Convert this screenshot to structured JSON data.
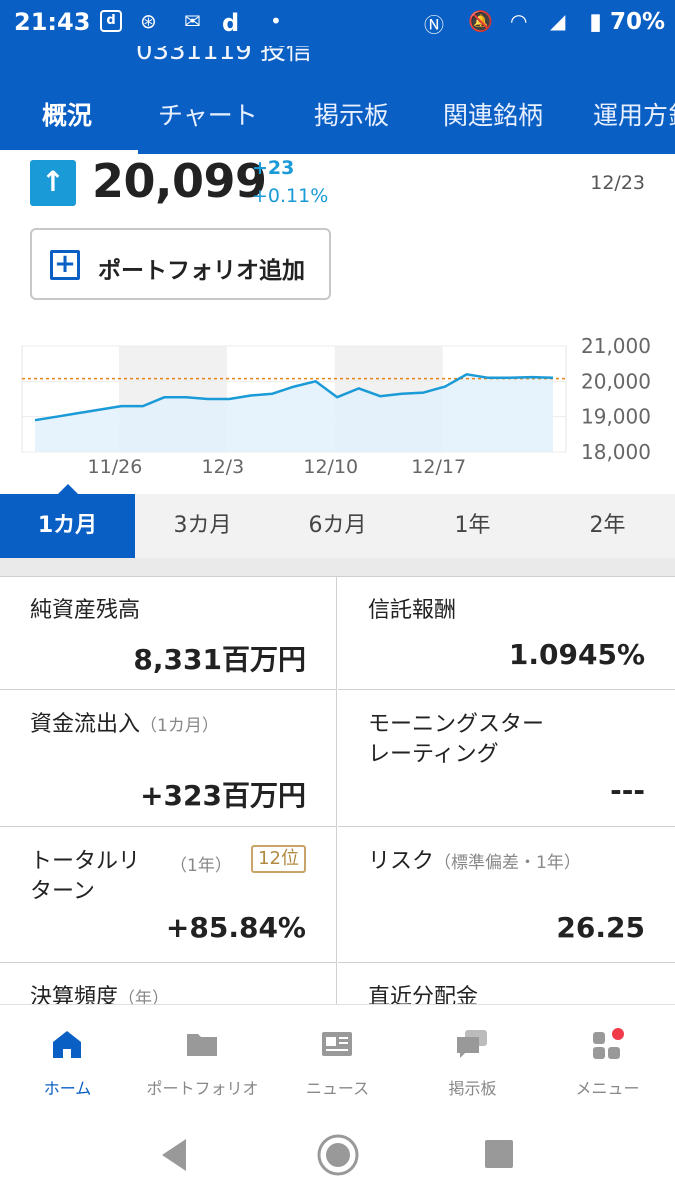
{
  "status": {
    "time": "21:43",
    "battery": "70%"
  },
  "header": {
    "title_clipped": "0331119 投信",
    "tabs": [
      "概況",
      "チャート",
      "掲示板",
      "関連銘柄",
      "運用方針"
    ]
  },
  "price": {
    "value": "20,099",
    "change": "+23",
    "change_pct": "+0.11%",
    "date": "12/23"
  },
  "portfolio_button": "ポートフォリオ追加",
  "chart_data": {
    "type": "line",
    "x": [
      "11/19",
      "11/20",
      "11/21",
      "11/22",
      "11/25",
      "11/26",
      "11/27",
      "11/28",
      "11/29",
      "12/2",
      "12/3",
      "12/4",
      "12/5",
      "12/6",
      "12/9",
      "12/10",
      "12/11",
      "12/12",
      "12/13",
      "12/16",
      "12/17",
      "12/18",
      "12/19",
      "12/20",
      "12/23"
    ],
    "series": [
      {
        "values": [
          18900,
          19000,
          19100,
          19200,
          19300,
          19300,
          19550,
          19550,
          19500,
          19500,
          19600,
          19650,
          19850,
          20000,
          19550,
          19800,
          19580,
          19650,
          19680,
          19850,
          20200,
          20100,
          20100,
          20120,
          20099
        ]
      }
    ],
    "xticks": [
      "11/26",
      "12/3",
      "12/10",
      "12/17"
    ],
    "yticks": [
      "21,000",
      "20,000",
      "19,000",
      "18,000"
    ],
    "ylim": [
      18000,
      21000
    ],
    "reference_line": 20076,
    "colors": {
      "line": "#1a9ad6",
      "fill": "#e3f1fb",
      "ref": "#e8830e"
    }
  },
  "ranges": [
    "1カ月",
    "3カ月",
    "6カ月",
    "1年",
    "2年"
  ],
  "stats": [
    {
      "label": "純資産残高",
      "sub": "",
      "value": "8,331百万円"
    },
    {
      "label": "信託報酬",
      "sub": "",
      "value": "1.0945%"
    },
    {
      "label": "資金流出入",
      "sub": "（1カ月）",
      "value": "+323百万円"
    },
    {
      "label": "モーニングスター レーティング",
      "sub": "",
      "value": "---"
    },
    {
      "label": "トータルリターン",
      "sub": "（1年）",
      "badge": "12位",
      "value": "+85.84%"
    },
    {
      "label": "リスク",
      "sub": "（標準偏差・1年）",
      "value": "26.25"
    },
    {
      "label": "決算頻度",
      "sub": "（年）",
      "value": ""
    },
    {
      "label": "直近分配金",
      "sub": "",
      "value": ""
    }
  ],
  "nav": [
    "ホーム",
    "ポートフォリオ",
    "ニュース",
    "掲示板",
    "メニュー"
  ]
}
